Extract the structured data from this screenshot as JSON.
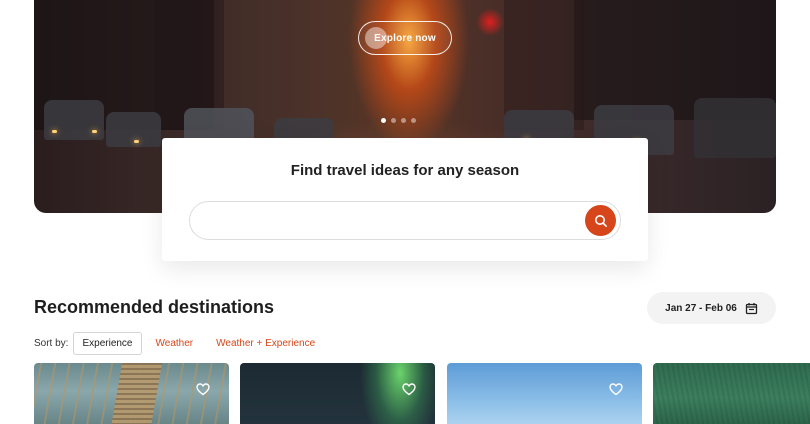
{
  "hero": {
    "explore_label": "Explore now",
    "slide_count": 4,
    "active_slide": 1
  },
  "search": {
    "title": "Find travel ideas for any season",
    "placeholder": "",
    "value": "",
    "button_icon": "search-icon"
  },
  "recommended": {
    "title": "Recommended destinations",
    "date_range": "Jan 27 - Feb 06",
    "date_icon": "calendar-icon"
  },
  "sort": {
    "label": "Sort by:",
    "options": [
      "Experience",
      "Weather",
      "Weather + Experience"
    ],
    "selected": "Experience"
  },
  "colors": {
    "accent": "#d6461a",
    "text": "#222222"
  },
  "cards": [
    {
      "icon": "heart-icon"
    },
    {
      "icon": "heart-icon"
    },
    {
      "icon": "heart-icon"
    },
    {
      "icon": ""
    }
  ]
}
